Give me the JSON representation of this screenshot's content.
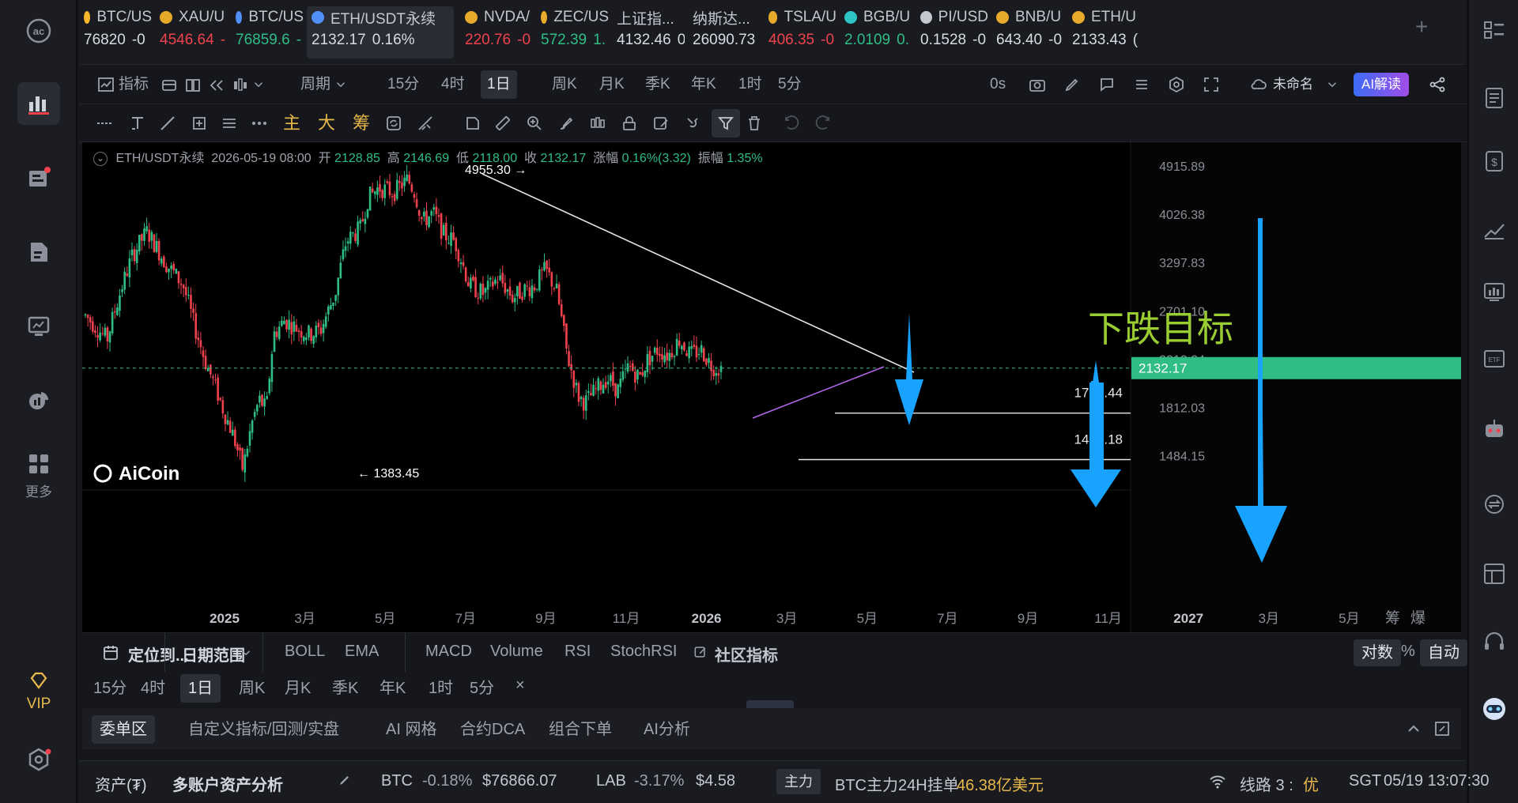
{
  "tickers": [
    {
      "name": "BTC/US",
      "price": "76820",
      "change": "-0",
      "color": "#f7b52c",
      "pc": "wh",
      "cc": "wh",
      "icon": "b-coin-icon"
    },
    {
      "name": "XAU/U",
      "price": "4546.64",
      "change": "-",
      "color": "#e7a92a",
      "pc": "dn",
      "cc": "dn",
      "icon": "gold-coin-icon"
    },
    {
      "name": "BTC/US",
      "price": "76859.6",
      "change": "-",
      "color": "#4f8ff7",
      "pc": "up",
      "cc": "up",
      "icon": "exchange-icon"
    },
    {
      "name": "ETH/USDT永续",
      "price": "2132.17",
      "change": "0.16%",
      "color": "#4f8ff7",
      "pc": "wh",
      "cc": "wh",
      "icon": "exchange-icon"
    },
    {
      "name": "NVDA/",
      "price": "220.76",
      "change": "-0",
      "color": "#e7a92a",
      "pc": "dn",
      "cc": "dn",
      "icon": "gold-coin-icon"
    },
    {
      "name": "ZEC/US",
      "price": "572.39",
      "change": "1.",
      "color": "#e7a92a",
      "pc": "up",
      "cc": "up",
      "icon": "gold-coin-icon"
    },
    {
      "name": "上证指...",
      "price": "4132.46",
      "change": "0",
      "color": "",
      "pc": "wh",
      "cc": "wh",
      "icon": ""
    },
    {
      "name": "纳斯达...",
      "price": "26090.73",
      "change": "",
      "color": "",
      "pc": "wh",
      "cc": "wh",
      "icon": ""
    },
    {
      "name": "TSLA/U",
      "price": "406.35",
      "change": "-0",
      "color": "#e7a92a",
      "pc": "dn",
      "cc": "dn",
      "icon": "gold-coin-icon"
    },
    {
      "name": "BGB/U",
      "price": "2.0109",
      "change": "0.",
      "color": "#2ec4c4",
      "pc": "up",
      "cc": "up",
      "icon": "bgb-icon"
    },
    {
      "name": "PI/USD",
      "price": "0.1528",
      "change": "-0",
      "color": "#c4c7ce",
      "pc": "wh",
      "cc": "wh",
      "icon": "dots-icon"
    },
    {
      "name": "BNB/U",
      "price": "643.40",
      "change": "-0",
      "color": "#e7a92a",
      "pc": "wh",
      "cc": "wh",
      "icon": "gold-coin-icon"
    },
    {
      "name": "ETH/U",
      "price": "2133.43",
      "change": "(",
      "color": "#e7a92a",
      "pc": "wh",
      "cc": "wh",
      "icon": "gold-coin-icon"
    }
  ],
  "toolbar": {
    "indicator": "指标",
    "period": "周期",
    "timeframes": [
      "15分",
      "4时",
      "1日",
      "周K",
      "月K",
      "季K",
      "年K",
      "1时",
      "5分"
    ],
    "selected_tf": "1日",
    "countdown": "0s",
    "layout_name": "未命名",
    "ai_button": "AI解读",
    "draw_labels": {
      "main": "主",
      "big": "大",
      "chips": "筹"
    }
  },
  "chart": {
    "symbol": "ETH/USDT永续",
    "date": "2026-05-19 08:00",
    "open_label": "开",
    "open": "2128.85",
    "high_label": "高",
    "high": "2146.69",
    "low_label": "低",
    "low": "2118.00",
    "close_label": "收",
    "close": "2132.17",
    "chg_label": "涨幅",
    "chg": "0.16%(3.32)",
    "amp_label": "振幅",
    "amp": "1.35%",
    "y_ticks": [
      "4915.89",
      "4026.38",
      "3297.83",
      "2701.10",
      "2212.24",
      "1812.03",
      "1484.15"
    ],
    "current_price": "2132.17",
    "x_ticks": [
      "2025",
      "3月",
      "5月",
      "7月",
      "9月",
      "11月",
      "2026",
      "3月",
      "5月",
      "7月",
      "9月",
      "11月",
      "2027",
      "3月",
      "5月"
    ],
    "corner_labels": [
      "筹",
      "爆"
    ],
    "high_marker": "4955.30",
    "low_marker": "1383.45",
    "target1": "1770.44",
    "target2": "1461.18",
    "annotation": "下跌目标",
    "logo": "AiCoin"
  },
  "indicator_bar": {
    "locate": "定位到...",
    "range": "日期范围",
    "main_inds": [
      "BOLL",
      "EMA"
    ],
    "sub_inds": [
      "MACD",
      "Volume",
      "RSI",
      "StochRSI"
    ],
    "community": "社区指标",
    "log": "对数",
    "pct": "%",
    "auto": "自动"
  },
  "quick_tf": {
    "items": [
      "15分",
      "4时",
      "1日",
      "周K",
      "月K",
      "季K",
      "年K",
      "1时",
      "5分"
    ],
    "selected": "1日",
    "close": "×"
  },
  "tabs": [
    "委单区",
    "自定义指标/回测/实盘",
    "AI 网格",
    "合约DCA",
    "组合下单",
    "AI分析"
  ],
  "status": {
    "assets": "资产(₮)",
    "multi": "多账户资产分析",
    "coin1": "BTC",
    "coin1_chg": "-0.18%",
    "coin1_price": "$76866.07",
    "coin2": "LAB",
    "coin2_chg": "-3.17%",
    "coin2_price": "$4.58",
    "badge": "主力",
    "main_text": "BTC主力24H挂单",
    "main_value": "46.38亿美元",
    "line": "线路 3 :",
    "line_q": "优",
    "tz": "SGT",
    "time": "05/19 13:07:30"
  },
  "sidebar": {
    "more": "更多",
    "vip": "VIP"
  }
}
